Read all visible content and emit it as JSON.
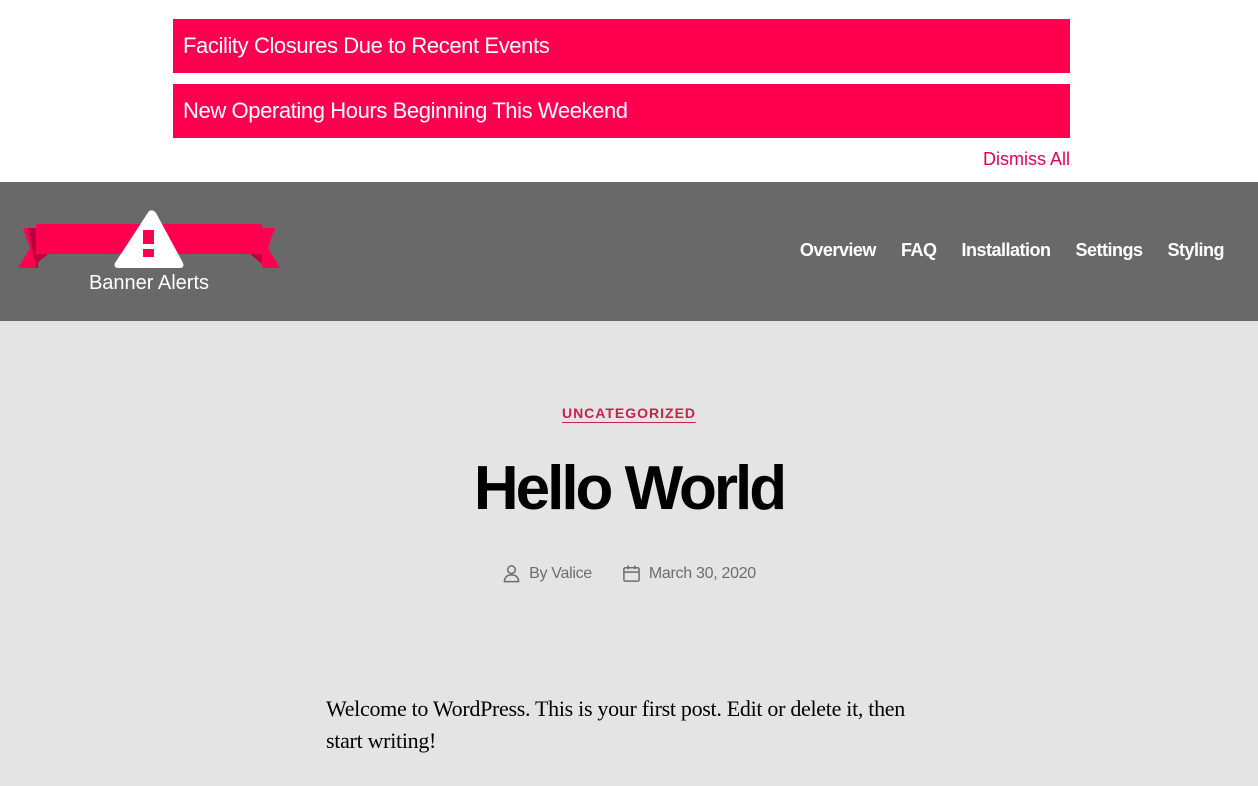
{
  "alerts": {
    "items": [
      {
        "title": "Facility Closures Due to Recent Events"
      },
      {
        "title": "New Operating Hours Beginning This Weekend"
      }
    ],
    "dismiss_label": "Dismiss All",
    "color": "#ff0050"
  },
  "header": {
    "background": "#696969",
    "logo_text": "Banner Alerts",
    "nav": [
      "Overview",
      "FAQ",
      "Installation",
      "Settings",
      "Styling"
    ]
  },
  "post": {
    "category": "UNCATEGORIZED",
    "title": "Hello World",
    "author_label": "By Valice",
    "date": "March 30, 2020",
    "body": "Welcome to WordPress. This is your first post. Edit or delete it, then start writing!",
    "icons": [
      "user-icon",
      "calendar-icon"
    ]
  }
}
